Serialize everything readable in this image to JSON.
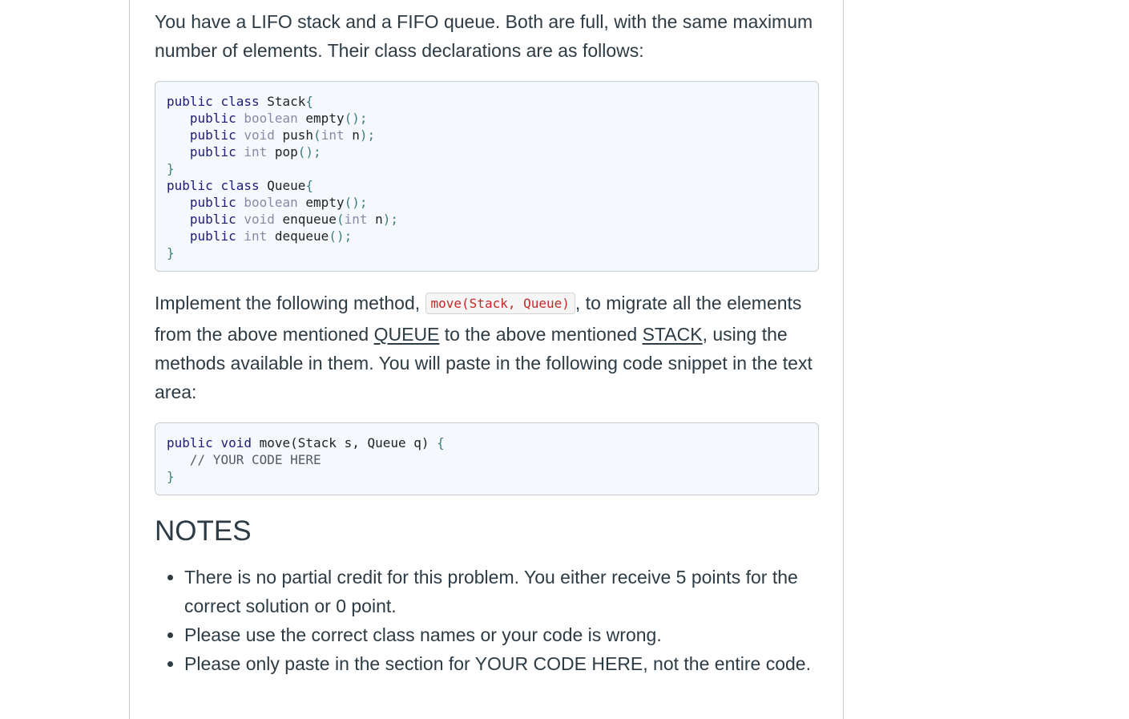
{
  "intro": "You have a LIFO stack and a FIFO queue. Both are full, with the same maximum number of elements. Their class declarations are as follows:",
  "code_block_1": {
    "stack_class": "public class Stack{",
    "stack_methods": [
      "public boolean empty();",
      "public void push(int n);",
      "public int pop();"
    ],
    "close_brace": "}",
    "queue_class": "public class Queue{",
    "queue_methods": [
      "public boolean empty();",
      "public void enqueue(int n);",
      "public int dequeue();"
    ]
  },
  "task": {
    "part1": "Implement the following method, ",
    "method_code": "move(Stack, Queue)",
    "part2": ", to migrate all the elements from the above mentioned ",
    "queue_word": "QUEUE",
    "part3": " to the above mentioned ",
    "stack_word": "STACK",
    "part4": ", using the methods available in them. You will paste in the following code snippet in the text area:"
  },
  "code_block_2": {
    "signature": "public void move(Stack s, Queue q) {",
    "comment": "// YOUR CODE HERE",
    "close_brace": "}"
  },
  "notes": {
    "heading": "NOTES",
    "items": [
      "There is no partial credit for this problem. You either receive 5 points for the correct solution or 0 point.",
      "Please use the correct class names or your code is wrong.",
      "Please only paste in the section for YOUR CODE HERE, not the entire code."
    ]
  }
}
